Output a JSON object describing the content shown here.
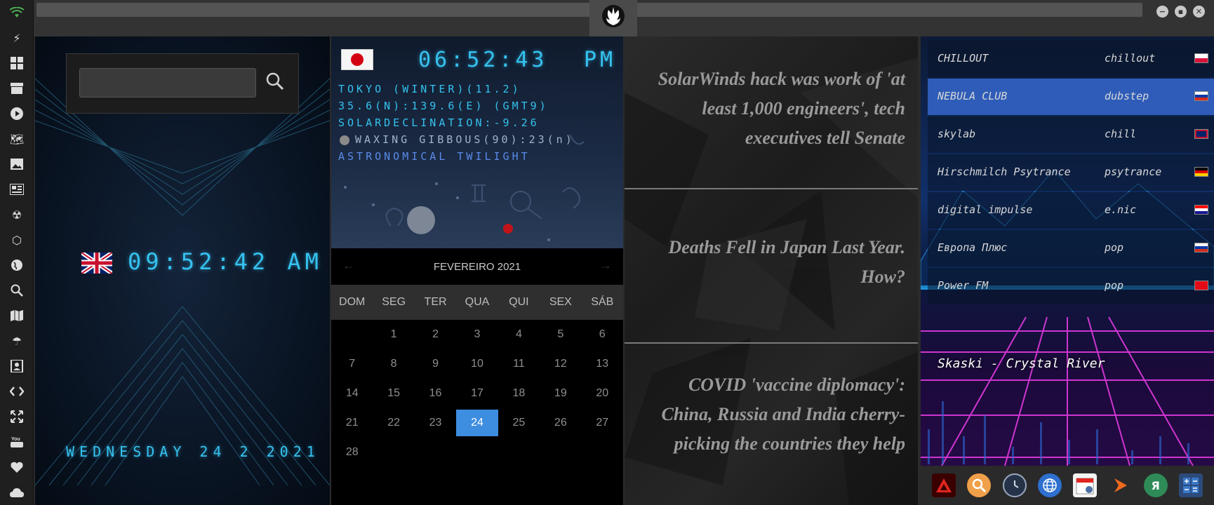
{
  "sidebar": {
    "icons": [
      "wifi-icon",
      "bolt-icon",
      "windows-icon",
      "archive-icon",
      "play-icon",
      "map-book-icon",
      "image-icon",
      "news-icon",
      "radiation-icon",
      "hexagon-icon",
      "globe-icon",
      "search-icon",
      "map-icon",
      "umbrella-icon",
      "contacts-icon",
      "code-icon",
      "expand-icon",
      "youtube-icon",
      "heart-icon",
      "cloud-icon"
    ]
  },
  "search": {
    "value": "",
    "placeholder": ""
  },
  "uk_clock": {
    "time": "09:52:42 AM",
    "date": "WEDNESDAY 24 2 2021"
  },
  "jp_clock": {
    "time": "06:52:43",
    "ampm": "PM",
    "line1": "TOKYO (WINTER)(11.2)",
    "line2": "35.6(N):139.6(E) (GMT9)",
    "line3": "SOLARDECLINATION:-9.26",
    "line4": "WAXING GIBBOUS(90):23(n)",
    "line5": "ASTRONOMICAL TWILIGHT"
  },
  "calendar": {
    "month": "FEVEREIRO 2021",
    "prev": "←",
    "next": "→",
    "weekdays": [
      "DOM",
      "SEG",
      "TER",
      "QUA",
      "QUI",
      "SEX",
      "SÁB"
    ],
    "weeks": [
      [
        "",
        "1",
        "2",
        "3",
        "4",
        "5",
        "6"
      ],
      [
        "7",
        "8",
        "9",
        "10",
        "11",
        "12",
        "13"
      ],
      [
        "14",
        "15",
        "16",
        "17",
        "18",
        "19",
        "20"
      ],
      [
        "21",
        "22",
        "23",
        "24",
        "25",
        "26",
        "27"
      ],
      [
        "28",
        "",
        "",
        "",
        "",
        "",
        ""
      ]
    ],
    "today": "24"
  },
  "news": [
    "SolarWinds hack was work of 'at least 1,000 engineers', tech executives tell Senate",
    "Deaths Fell in Japan Last Year. How?",
    "COVID 'vaccine diplomacy': China, Russia and India cherry-picking the countries they help"
  ],
  "radio": {
    "stations": [
      {
        "name": "CHILLOUT",
        "genre": "chillout",
        "flag": "poland"
      },
      {
        "name": "NEBULA CLUB",
        "genre": "dubstep",
        "flag": "russia"
      },
      {
        "name": "skylab",
        "genre": "chill",
        "flag": "uk"
      },
      {
        "name": "Hirschmilch Psytrance",
        "genre": "psytrance",
        "flag": "germany"
      },
      {
        "name": "digital impulse",
        "genre": "e.nic",
        "flag": "croatia"
      },
      {
        "name": "Европа Плюс",
        "genre": "pop",
        "flag": "russia"
      },
      {
        "name": "Power FM",
        "genre": "pop",
        "flag": "turkey"
      }
    ],
    "selected": 1,
    "now_playing": "Skaski - Crystal River",
    "dock": [
      "app-launcher-icon",
      "search-icon",
      "clock-icon",
      "globe-icon",
      "calendar-icon",
      "play-icon",
      "yandex-icon",
      "calculator-icon"
    ]
  }
}
